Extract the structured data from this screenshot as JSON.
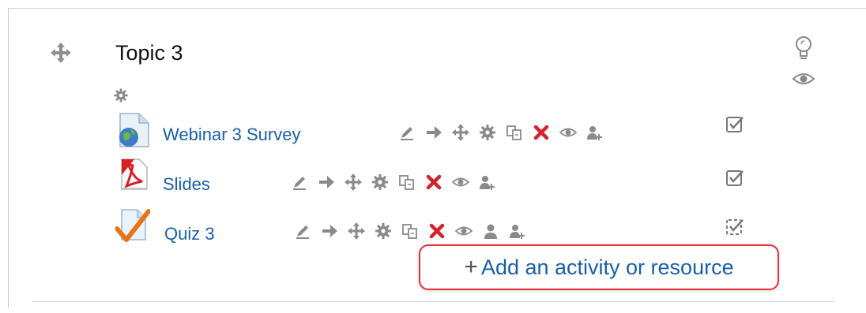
{
  "section": {
    "title": "Topic 3",
    "controls": [
      "highlight-icon",
      "eye-icon"
    ]
  },
  "activities": [
    {
      "name": "Webinar 3 Survey",
      "icon": "survey-globe-icon",
      "tools": [
        "edit-icon",
        "move-right-icon",
        "move-icon",
        "settings-icon",
        "duplicate-icon",
        "delete-icon",
        "hide-icon",
        "assign-roles-icon"
      ],
      "completion": "manual-checked"
    },
    {
      "name": "Slides",
      "icon": "pdf-icon",
      "tools": [
        "edit-icon",
        "move-right-icon",
        "move-icon",
        "settings-icon",
        "duplicate-icon",
        "delete-icon",
        "hide-icon",
        "assign-roles-icon"
      ],
      "completion": "manual-checked"
    },
    {
      "name": "Quiz 3",
      "icon": "quiz-icon",
      "tools": [
        "edit-icon",
        "move-right-icon",
        "move-icon",
        "settings-icon",
        "duplicate-icon",
        "delete-icon",
        "hide-icon",
        "group-mode-icon",
        "assign-roles-icon"
      ],
      "completion": "automatic-checked"
    }
  ],
  "add_activity": {
    "plus": "+",
    "label": "Add an activity or resource"
  },
  "colors": {
    "link": "#1a5fa6",
    "delete": "#d0232b",
    "icon_gray": "#8a8a8a",
    "highlight_border": "#e0303a"
  }
}
